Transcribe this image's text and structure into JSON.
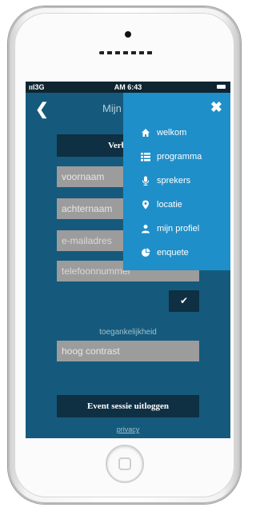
{
  "statusbar": {
    "signal": "3G",
    "time": "AM 6:43"
  },
  "appbar": {
    "title": "Mijn"
  },
  "form": {
    "connect_button": "Verbind m",
    "fields": {
      "first_name": "voornaam",
      "last_name": "achternaam",
      "email": "e-mailadres",
      "phone": "telefoonnummer"
    },
    "submit_icon": "check-icon",
    "accessibility_label": "toegankelijkheid",
    "contrast_value": "hoog contrast",
    "logout_button": "Event sessie uitloggen",
    "privacy_link": "privacy"
  },
  "menu": {
    "close_icon": "close-icon",
    "items": [
      {
        "label": "welkom",
        "icon": "home-icon"
      },
      {
        "label": "programma",
        "icon": "list-icon"
      },
      {
        "label": "sprekers",
        "icon": "microphone-icon"
      },
      {
        "label": "locatie",
        "icon": "map-marker-icon"
      },
      {
        "label": "mijn profiel",
        "icon": "user-icon"
      },
      {
        "label": "enquete",
        "icon": "pie-chart-icon"
      }
    ]
  },
  "colors": {
    "screen_background": "#155a7c",
    "menu_background": "#1f8fc9",
    "button_dark": "#0f2f43",
    "field_gray": "#9c9c9c"
  }
}
